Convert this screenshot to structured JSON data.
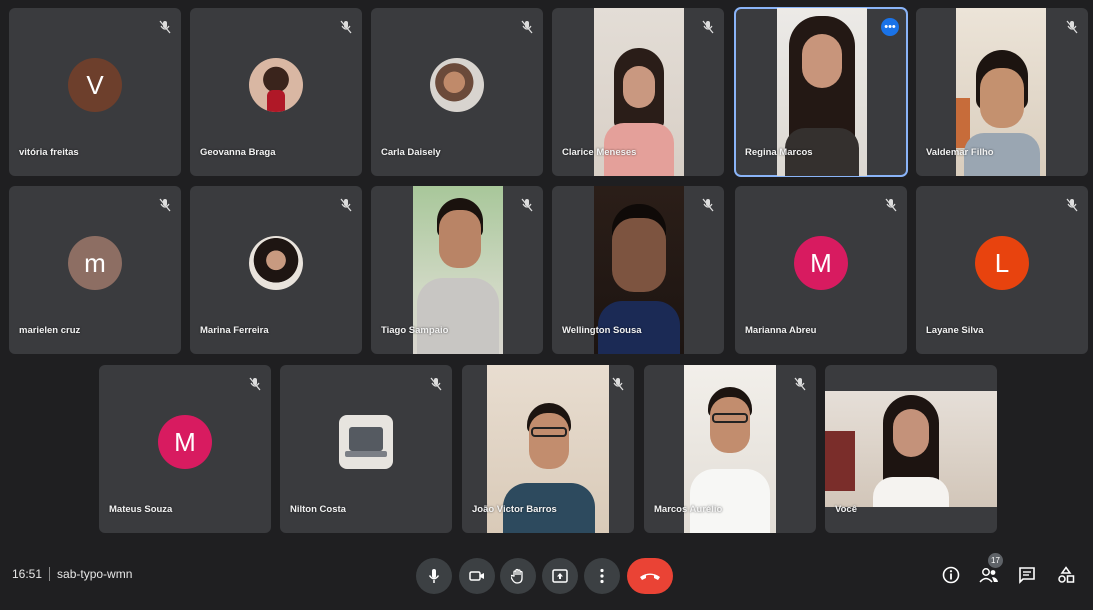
{
  "participants": [
    {
      "name": "vitória freitas",
      "kind": "initial",
      "initial": "V",
      "color": "#6d3f2c"
    },
    {
      "name": "Geovanna Braga",
      "kind": "photo"
    },
    {
      "name": "Carla Daisely",
      "kind": "photo"
    },
    {
      "name": "Clarice Meneses",
      "kind": "video"
    },
    {
      "name": "Regina Marcos",
      "kind": "video",
      "active": true
    },
    {
      "name": "Valdemar Filho",
      "kind": "video"
    },
    {
      "name": "marielen cruz",
      "kind": "initial",
      "initial": "m",
      "color": "#8d6e63"
    },
    {
      "name": "Marina Ferreira",
      "kind": "photo"
    },
    {
      "name": "Tiago Sampaio",
      "kind": "video"
    },
    {
      "name": "Wellington Sousa",
      "kind": "video"
    },
    {
      "name": "Marianna Abreu",
      "kind": "initial",
      "initial": "M",
      "color": "#d81b60"
    },
    {
      "name": "Layane Silva",
      "kind": "initial",
      "initial": "L",
      "color": "#e8430e"
    },
    {
      "name": "Mateus Souza",
      "kind": "initial",
      "initial": "M",
      "color": "#d81b60"
    },
    {
      "name": "Nilton Costa",
      "kind": "photo"
    },
    {
      "name": "João Victor Barros",
      "kind": "video"
    },
    {
      "name": "Marcos Aurélio",
      "kind": "video"
    },
    {
      "name": "Você",
      "kind": "video"
    }
  ],
  "bottom_bar": {
    "time": "16:51",
    "meeting_code": "sab-typo-wmn",
    "participants_count": "17"
  },
  "icons": {
    "mic": "mic-icon",
    "camera": "camera-icon",
    "raise_hand": "hand-icon",
    "present": "present-screen-icon",
    "more": "more-options-icon",
    "end_call": "end-call-icon",
    "info": "info-icon",
    "people": "people-icon",
    "chat": "chat-icon",
    "activities": "activities-icon",
    "muted": "mic-off-icon"
  },
  "colors": {
    "background": "#1f1f21",
    "tile": "#3a3b3e",
    "accent": "#8ab4f8",
    "end_call": "#ea4335"
  }
}
